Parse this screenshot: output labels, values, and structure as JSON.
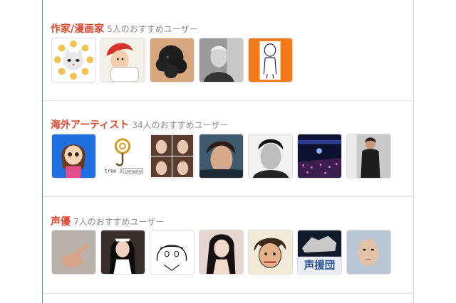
{
  "sections": [
    {
      "category": "作家/漫画家",
      "count_text": "5人のおすすめユーザー",
      "users": [
        {
          "icon": "cat-face-avatar"
        },
        {
          "icon": "red-hair-chef-avatar"
        },
        {
          "icon": "black-poodle-avatar"
        },
        {
          "icon": "elderly-man-avatar"
        },
        {
          "icon": "sketch-man-orange-avatar"
        }
      ]
    },
    {
      "category": "海外アーティスト",
      "count_text": "34人のおすすめユーザー",
      "users": [
        {
          "icon": "cartoon-girl-avatar"
        },
        {
          "icon": "tree-j-company-logo-avatar",
          "logo_text": "tree J",
          "logo_sub": "company"
        },
        {
          "icon": "selfie-collage-avatar"
        },
        {
          "icon": "young-man-photo-avatar"
        },
        {
          "icon": "bw-portrait-avatar"
        },
        {
          "icon": "concert-crowd-avatar"
        },
        {
          "icon": "street-man-avatar"
        }
      ]
    },
    {
      "category": "声優",
      "count_text": "7人のおすすめユーザー",
      "users": [
        {
          "icon": "hand-gesture-avatar"
        },
        {
          "icon": "maid-cosplay-avatar"
        },
        {
          "icon": "lineart-girl-avatar"
        },
        {
          "icon": "long-hair-woman-avatar"
        },
        {
          "icon": "anime-sketch-man-avatar"
        },
        {
          "icon": "seien-dan-avatar",
          "logo_text": "声援団"
        },
        {
          "icon": "mannequin-face-avatar"
        }
      ]
    }
  ],
  "colors": {
    "category": "#e0452e",
    "count": "#8a8a8a",
    "divider": "#e6e6e6"
  }
}
